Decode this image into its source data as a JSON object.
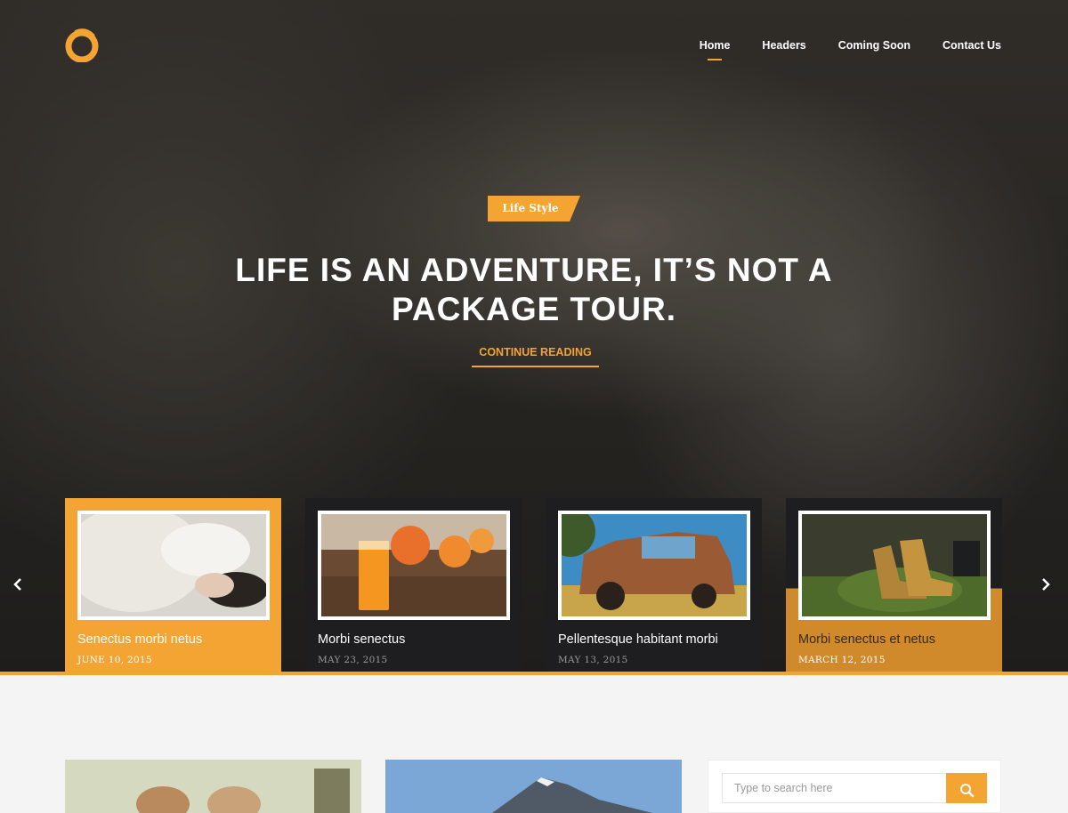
{
  "nav": {
    "items": [
      "Home",
      "Headers",
      "Coming Soon",
      "Contact Us"
    ],
    "active": "Home"
  },
  "hero": {
    "category": "Life Style",
    "headline_line1": "LIFE IS AN ADVENTURE, IT’S NOT A",
    "headline_line2": "PACKAGE TOUR.",
    "cta": "CONTINUE READING"
  },
  "carousel": {
    "prev_icon": "chevron-left-icon",
    "next_icon": "chevron-right-icon",
    "cards": [
      {
        "title": "Senectus morbi netus",
        "date": "JUNE 10, 2015"
      },
      {
        "title": "Morbi senectus",
        "date": "MAY 23, 2015"
      },
      {
        "title": "Pellentesque habitant morbi",
        "date": "MAY 13, 2015"
      },
      {
        "title": "Morbi senectus et netus",
        "date": "MARCH 12, 2015"
      }
    ]
  },
  "sidebar": {
    "search_placeholder": "Type to search here"
  },
  "colors": {
    "accent": "#f4a433",
    "dark_card": "#1e1e21"
  }
}
